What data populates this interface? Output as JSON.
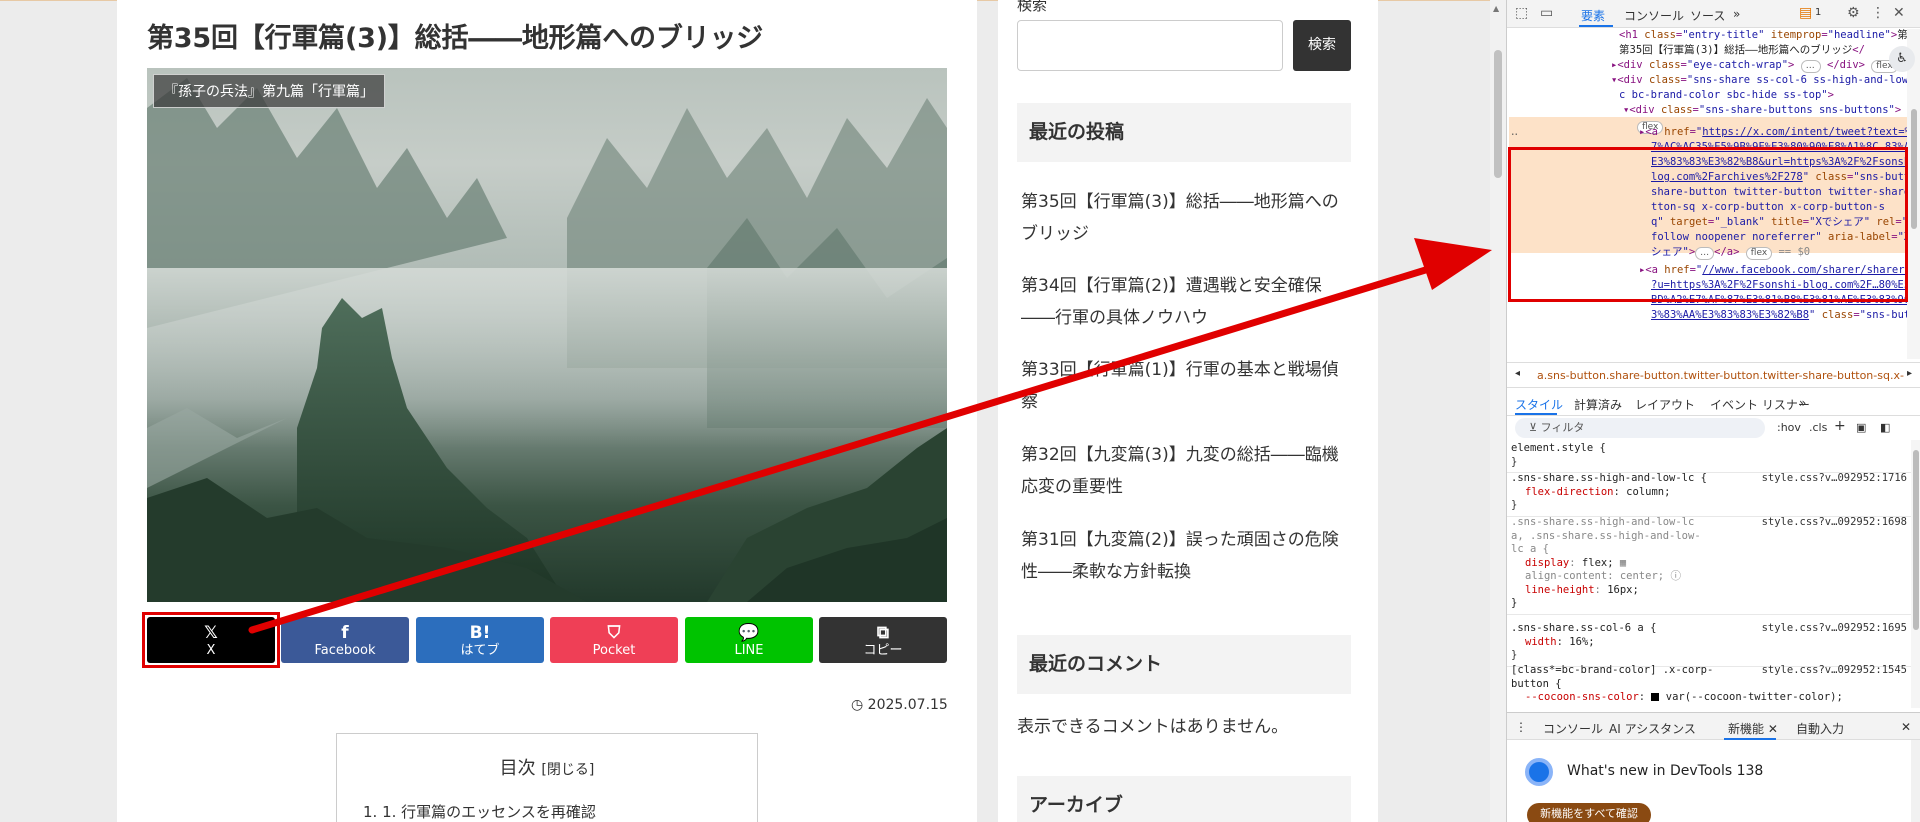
{
  "article": {
    "title": "第35回【行軍篇(3)】総括――地形篇へのブリッジ",
    "category_label": "『孫子の兵法』第九篇「行軍篇」",
    "share_buttons": [
      {
        "icon": "x-icon",
        "glyph": "𝕏",
        "label": "X",
        "color": "#000000"
      },
      {
        "icon": "facebook-icon",
        "glyph": "f",
        "label": "Facebook",
        "color": "#3b5998"
      },
      {
        "icon": "hatena-icon",
        "glyph": "B!",
        "label": "はてブ",
        "color": "#2c6ebd"
      },
      {
        "icon": "pocket-icon",
        "glyph": "⛉",
        "label": "Pocket",
        "color": "#ef3f56"
      },
      {
        "icon": "line-icon",
        "glyph": "💬",
        "label": "LINE",
        "color": "#00c300"
      },
      {
        "icon": "copy-icon",
        "glyph": "⧉",
        "label": "コピー",
        "color": "#333333"
      }
    ],
    "date_icon": "clock-icon",
    "date": "2025.07.15",
    "toc": {
      "title": "目次",
      "toggle": "[閉じる]",
      "items": [
        "1. 1. 行軍篇のエッセンスを再確認"
      ]
    }
  },
  "sidebar": {
    "search_label": "検索",
    "search_placeholder": "",
    "search_button": "検索",
    "recent_posts_title": "最近の投稿",
    "recent_posts": [
      "第35回【行軍篇(3)】総括――地形篇へのブリッジ",
      "第34回【行軍篇(2)】遭遇戦と安全確保――行軍の具体ノウハウ",
      "第33回【行軍篇(1)】行軍の基本と戦場偵察",
      "第32回【九変篇(3)】九変の総括――臨機応変の重要性",
      "第31回【九変篇(2)】誤った頑固さの危険性――柔軟な方針転換"
    ],
    "recent_comments_title": "最近のコメント",
    "no_comments": "表示できるコメントはありません。",
    "archive_title": "アーカイブ"
  },
  "devtools": {
    "top_tabs": [
      "要素",
      "コンソール",
      "ソース",
      "»"
    ],
    "badge_count": "1",
    "dom": {
      "h1_text": "第35回【行軍篇(3)】総括――地形篇へのブリッジ",
      "eyecatch_class": "eye-catch-wrap",
      "sns_share_class": "sns-share ss-col-6 ss-high-and-low-lc bc-brand-color sbc-hide ss-top",
      "sns_buttons_class": "sns-share-buttons sns-buttons",
      "selected_href_lines": [
        "https://x.com/intent/tweet?text=%E",
        "7%AC%AC35%E5%9B%9E%E3%80%90%E8%A1%8C…83%AA%",
        "E3%83%83%E3%82%B8&url=https%3A%2F%2Fsonshi-b",
        "log.com%2Farchives%2F278"
      ],
      "selected_class_lines": [
        "share-button twitter-button twitter-share-bu",
        "tton-sq x-corp-button x-corp-button-s",
        "q"
      ],
      "selected_target": "_blank",
      "selected_title": "Xでシェア",
      "selected_rel": "no",
      "selected_rel_rest": "follow noopener noreferrer",
      "selected_aria": "Xで",
      "selected_aria_rest": "シェア",
      "eq_badge": "== $0",
      "next_href_lines": [
        "//www.facebook.com/sharer/sharer.php",
        "?u=https%3A%2F%2Fsonshi-blog.com%2F…80%E5%",
        "BD%A2%E7%AF%87%E3%81%B8%E3%81%AE%E3%83%96%E",
        "3%83%AA%E3%83%83%E3%82%B8"
      ],
      "flex_pill": "flex"
    },
    "breadcrumb": "a.sns-button.share-button.twitter-button.twitter-share-button-sq.x-",
    "style_tabs": [
      "スタイル",
      "計算済み",
      "レイアウト",
      "イベント リスナー",
      "»"
    ],
    "filter_placeholder": "フィルタ",
    "filter_opts": [
      ":hov",
      ".cls",
      "+"
    ],
    "rules": [
      {
        "selector": "element.style {",
        "source": "",
        "props": [],
        "close": "}"
      },
      {
        "selector": ".sns-share.ss-high-and-low-lc {",
        "source": "style.css?v…092952:1716",
        "props": [
          {
            "name": "flex-direction",
            "value": "column;"
          }
        ],
        "close": "}"
      },
      {
        "selector": ".sns-share.ss-high-and-low-lc a, .sns-share.ss-high-and-low-lc a {",
        "source": "style.css?v…092952:1698",
        "props": [
          {
            "name": "display",
            "value": "flex;"
          },
          {
            "name": "align-content",
            "value": "center;"
          },
          {
            "name": "line-height",
            "value": "16px;"
          }
        ],
        "close": "}"
      },
      {
        "selector": ".sns-share.ss-col-6 a {",
        "source": "style.css?v…092952:1695",
        "props": [
          {
            "name": "width",
            "value": "16%;"
          }
        ],
        "close": "}"
      },
      {
        "selector": "[class*=bc-brand-color] .x-corp-button {",
        "source": "style.css?v…092952:1545",
        "props": [
          {
            "name": "--cocoon-sns-color",
            "value": "var(--cocoon-twitter-color);"
          }
        ],
        "close": ""
      }
    ],
    "drawer_tabs": [
      "コンソール",
      "AI アシスタンス",
      "新機能",
      "自動入力"
    ],
    "whatsnew_title": "What's new in DevTools 138",
    "whatsnew_button": "新機能をすべて確認"
  },
  "annotation": {
    "color": "#e00000"
  }
}
